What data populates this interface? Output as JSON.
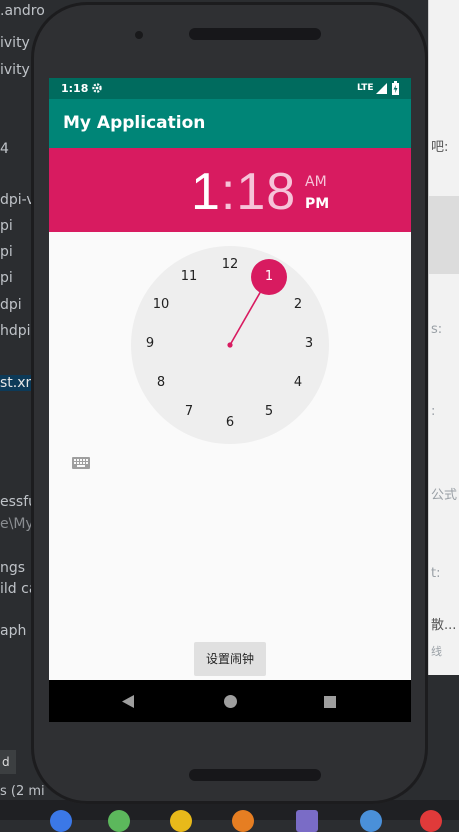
{
  "background_ide": {
    "left_lines": [
      ".andro",
      "ivity",
      "ivity",
      "4",
      "dpi-v",
      "pi",
      "pi",
      "pi",
      "dpi",
      "hdpi",
      "st.xm",
      "essfu",
      "e\\My",
      "ngs",
      "ild ca",
      "aph"
    ],
    "right_lines": [
      "吧:",
      "s:",
      ":",
      "",
      "公式",
      "t:",
      "散...",
      "线"
    ],
    "bottom_tab": "d",
    "bottom_status": "s (2 mi"
  },
  "device": {
    "status_bar": {
      "time": "1:18",
      "network": "LTE"
    },
    "app_title": "My Application",
    "time_picker": {
      "hour": "1",
      "separator": ":",
      "minute": "18",
      "am_label": "AM",
      "pm_label": "PM",
      "selected_period": "PM",
      "selected_hour": "1",
      "clock_numbers": [
        "12",
        "1",
        "2",
        "3",
        "4",
        "5",
        "6",
        "7",
        "8",
        "9",
        "10",
        "11"
      ]
    },
    "set_alarm_button": "设置闹钟"
  },
  "colors": {
    "primary": "#008577",
    "primary_dark": "#006b5e",
    "accent": "#d81b60"
  },
  "icons": {
    "settings": "gear-icon",
    "keyboard": "keyboard-icon",
    "back": "back-triangle-icon",
    "home": "home-circle-icon",
    "recents": "recents-square-icon"
  }
}
